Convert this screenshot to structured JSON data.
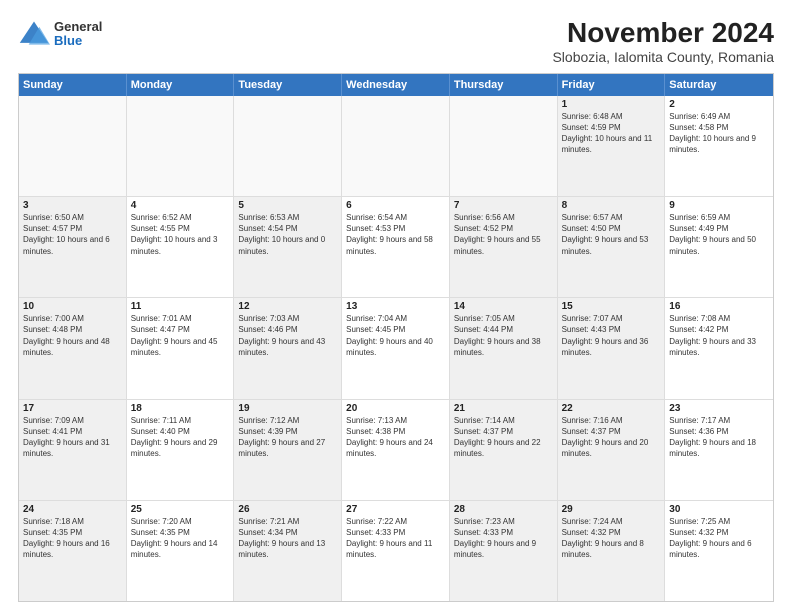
{
  "logo": {
    "general": "General",
    "blue": "Blue"
  },
  "title": "November 2024",
  "subtitle": "Slobozia, Ialomita County, Romania",
  "days": [
    "Sunday",
    "Monday",
    "Tuesday",
    "Wednesday",
    "Thursday",
    "Friday",
    "Saturday"
  ],
  "rows": [
    [
      {
        "day": "",
        "info": "",
        "empty": true
      },
      {
        "day": "",
        "info": "",
        "empty": true
      },
      {
        "day": "",
        "info": "",
        "empty": true
      },
      {
        "day": "",
        "info": "",
        "empty": true
      },
      {
        "day": "",
        "info": "",
        "empty": true
      },
      {
        "day": "1",
        "info": "Sunrise: 6:48 AM\nSunset: 4:59 PM\nDaylight: 10 hours and 11 minutes.",
        "shaded": true
      },
      {
        "day": "2",
        "info": "Sunrise: 6:49 AM\nSunset: 4:58 PM\nDaylight: 10 hours and 9 minutes."
      }
    ],
    [
      {
        "day": "3",
        "info": "Sunrise: 6:50 AM\nSunset: 4:57 PM\nDaylight: 10 hours and 6 minutes.",
        "shaded": true
      },
      {
        "day": "4",
        "info": "Sunrise: 6:52 AM\nSunset: 4:55 PM\nDaylight: 10 hours and 3 minutes."
      },
      {
        "day": "5",
        "info": "Sunrise: 6:53 AM\nSunset: 4:54 PM\nDaylight: 10 hours and 0 minutes.",
        "shaded": true
      },
      {
        "day": "6",
        "info": "Sunrise: 6:54 AM\nSunset: 4:53 PM\nDaylight: 9 hours and 58 minutes."
      },
      {
        "day": "7",
        "info": "Sunrise: 6:56 AM\nSunset: 4:52 PM\nDaylight: 9 hours and 55 minutes.",
        "shaded": true
      },
      {
        "day": "8",
        "info": "Sunrise: 6:57 AM\nSunset: 4:50 PM\nDaylight: 9 hours and 53 minutes.",
        "shaded": true
      },
      {
        "day": "9",
        "info": "Sunrise: 6:59 AM\nSunset: 4:49 PM\nDaylight: 9 hours and 50 minutes."
      }
    ],
    [
      {
        "day": "10",
        "info": "Sunrise: 7:00 AM\nSunset: 4:48 PM\nDaylight: 9 hours and 48 minutes.",
        "shaded": true
      },
      {
        "day": "11",
        "info": "Sunrise: 7:01 AM\nSunset: 4:47 PM\nDaylight: 9 hours and 45 minutes."
      },
      {
        "day": "12",
        "info": "Sunrise: 7:03 AM\nSunset: 4:46 PM\nDaylight: 9 hours and 43 minutes.",
        "shaded": true
      },
      {
        "day": "13",
        "info": "Sunrise: 7:04 AM\nSunset: 4:45 PM\nDaylight: 9 hours and 40 minutes."
      },
      {
        "day": "14",
        "info": "Sunrise: 7:05 AM\nSunset: 4:44 PM\nDaylight: 9 hours and 38 minutes.",
        "shaded": true
      },
      {
        "day": "15",
        "info": "Sunrise: 7:07 AM\nSunset: 4:43 PM\nDaylight: 9 hours and 36 minutes.",
        "shaded": true
      },
      {
        "day": "16",
        "info": "Sunrise: 7:08 AM\nSunset: 4:42 PM\nDaylight: 9 hours and 33 minutes."
      }
    ],
    [
      {
        "day": "17",
        "info": "Sunrise: 7:09 AM\nSunset: 4:41 PM\nDaylight: 9 hours and 31 minutes.",
        "shaded": true
      },
      {
        "day": "18",
        "info": "Sunrise: 7:11 AM\nSunset: 4:40 PM\nDaylight: 9 hours and 29 minutes."
      },
      {
        "day": "19",
        "info": "Sunrise: 7:12 AM\nSunset: 4:39 PM\nDaylight: 9 hours and 27 minutes.",
        "shaded": true
      },
      {
        "day": "20",
        "info": "Sunrise: 7:13 AM\nSunset: 4:38 PM\nDaylight: 9 hours and 24 minutes."
      },
      {
        "day": "21",
        "info": "Sunrise: 7:14 AM\nSunset: 4:37 PM\nDaylight: 9 hours and 22 minutes.",
        "shaded": true
      },
      {
        "day": "22",
        "info": "Sunrise: 7:16 AM\nSunset: 4:37 PM\nDaylight: 9 hours and 20 minutes.",
        "shaded": true
      },
      {
        "day": "23",
        "info": "Sunrise: 7:17 AM\nSunset: 4:36 PM\nDaylight: 9 hours and 18 minutes."
      }
    ],
    [
      {
        "day": "24",
        "info": "Sunrise: 7:18 AM\nSunset: 4:35 PM\nDaylight: 9 hours and 16 minutes.",
        "shaded": true
      },
      {
        "day": "25",
        "info": "Sunrise: 7:20 AM\nSunset: 4:35 PM\nDaylight: 9 hours and 14 minutes."
      },
      {
        "day": "26",
        "info": "Sunrise: 7:21 AM\nSunset: 4:34 PM\nDaylight: 9 hours and 13 minutes.",
        "shaded": true
      },
      {
        "day": "27",
        "info": "Sunrise: 7:22 AM\nSunset: 4:33 PM\nDaylight: 9 hours and 11 minutes."
      },
      {
        "day": "28",
        "info": "Sunrise: 7:23 AM\nSunset: 4:33 PM\nDaylight: 9 hours and 9 minutes.",
        "shaded": true
      },
      {
        "day": "29",
        "info": "Sunrise: 7:24 AM\nSunset: 4:32 PM\nDaylight: 9 hours and 8 minutes.",
        "shaded": true
      },
      {
        "day": "30",
        "info": "Sunrise: 7:25 AM\nSunset: 4:32 PM\nDaylight: 9 hours and 6 minutes."
      }
    ]
  ]
}
